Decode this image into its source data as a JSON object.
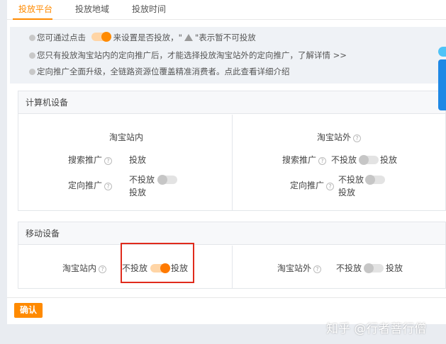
{
  "tabs": [
    {
      "label": "投放平台",
      "active": true
    },
    {
      "label": "投放地域",
      "active": false
    },
    {
      "label": "投放时间",
      "active": false
    }
  ],
  "notice": {
    "line1_a": "您可通过点击",
    "line1_b": "来设置是否投放，\"",
    "line1_c": "\"表示暂不可投放",
    "line2_a": "您只有投放淘宝站内的定向推广后，才能选择投放淘宝站外的定向推广，",
    "line2_link": "了解详情 >>",
    "line3": "定向推广全面升级，全链路资源位覆盖精准消费者。点此查看详细介绍"
  },
  "computer": {
    "title": "计算机设备",
    "inside_title": "淘宝站内",
    "outside_title": "淘宝站外",
    "search_label": "搜索推广",
    "target_label": "定向推广",
    "inside_search_value": "投放",
    "inside_target_off": "不投放",
    "inside_target_on": "投放",
    "outside_search_off": "不投放",
    "outside_search_on": "投放",
    "outside_target_off": "不投放",
    "outside_target_on": "投放"
  },
  "mobile": {
    "title": "移动设备",
    "inside_label": "淘宝站内",
    "inside_off": "不投放",
    "inside_on": "投放",
    "outside_label": "淘宝站外",
    "outside_off": "不投放",
    "outside_on": "投放"
  },
  "confirm_label": "确认",
  "watermark": "知乎 @行者菩行僧",
  "colors": {
    "accent": "#ff8a00",
    "highlight_border": "#e02b1c",
    "side_widget": "#1e88e5"
  }
}
